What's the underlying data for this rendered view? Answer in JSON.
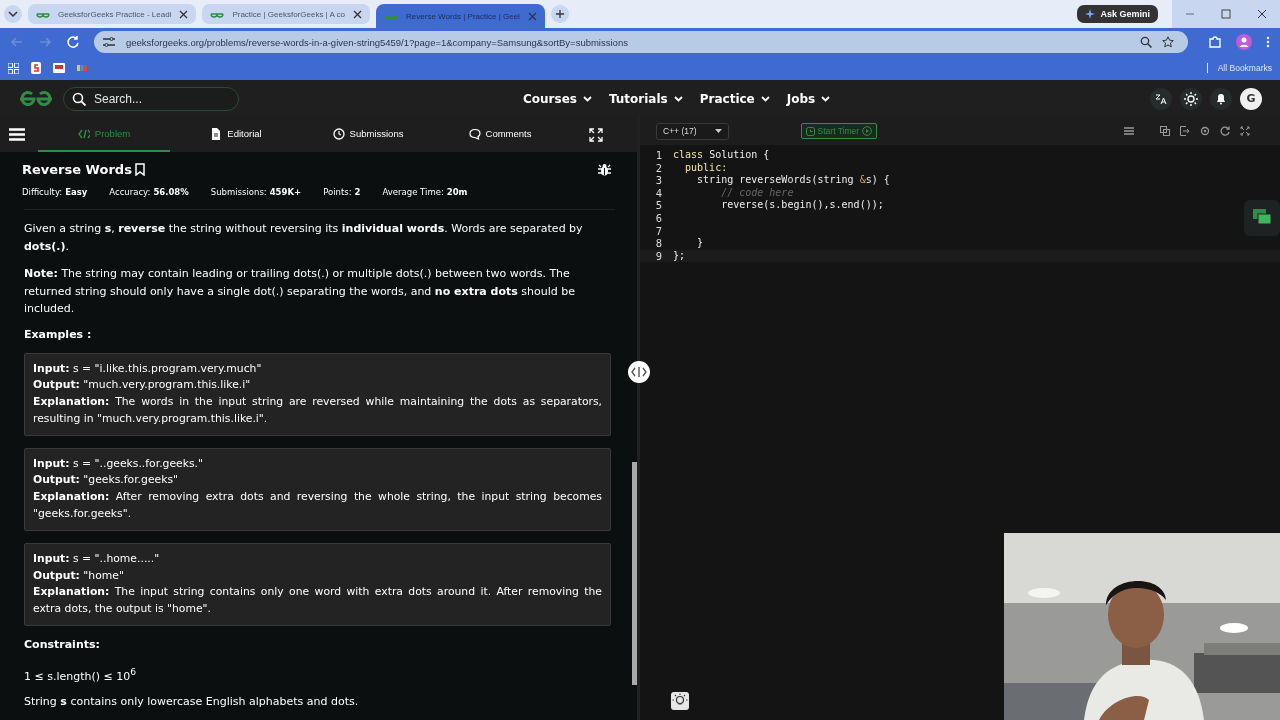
{
  "browser": {
    "tabs": [
      {
        "title": "GeeksforGeeks Practice - Leadi",
        "selected": false
      },
      {
        "title": "Practice | GeeksforGeeks | A co",
        "selected": false
      },
      {
        "title": "Reverse Words | Practice | Geel",
        "selected": true
      }
    ],
    "ask_button": "Ask Gemini",
    "url": "geeksforgeeks.org/problems/reverse-words-in-a-given-string5459/1?page=1&company=Samsung&sortBy=submissions",
    "bookmarks_label": "All Bookmarks"
  },
  "site_header": {
    "search_placeholder": "Search...",
    "nav": [
      "Courses",
      "Tutorials",
      "Practice",
      "Jobs"
    ],
    "avatar": "G"
  },
  "problem_tabs": [
    {
      "label": "Problem",
      "selected": true
    },
    {
      "label": "Editorial",
      "selected": false
    },
    {
      "label": "Submissions",
      "selected": false
    },
    {
      "label": "Comments",
      "selected": false
    }
  ],
  "problem": {
    "title": "Reverse Words",
    "meta": [
      {
        "label": "Difficulty:",
        "value": "Easy"
      },
      {
        "label": "Accuracy:",
        "value": "56.08%"
      },
      {
        "label": "Submissions:",
        "value": "459K+"
      },
      {
        "label": "Points:",
        "value": "2"
      },
      {
        "label": "Average Time:",
        "value": "20m"
      }
    ],
    "paragraphs": [
      "Given a string **s**, **reverse** the string without reversing its **individual words**. Words are separated by **dots(.)**.",
      "**Note:** The string may contain leading or trailing dots(.) or multiple dots(.) between two words. The returned string should only have a single dot(.) separating the words, and **no extra dots** should be included."
    ],
    "examples_heading": "Examples :",
    "examples": [
      [
        "**Input:** s = \"i.like.this.program.very.much\"",
        "**Output:** \"much.very.program.this.like.i\"",
        "**Explanation:** The words in the input string are reversed while maintaining the dots as separators, resulting in \"much.very.program.this.like.i\"."
      ],
      [
        "**Input:** s = \"..geeks..for.geeks.\"",
        "**Output:** \"geeks.for.geeks\"",
        "**Explanation:** After removing extra dots and reversing the whole string, the input string becomes \"geeks.for.geeks\"."
      ],
      [
        "**Input:** s = \"..home.....\"",
        "**Output:** \"home\"",
        "**Explanation:** The input string contains only one word with extra dots around it. After removing the extra dots, the output is \"home\"."
      ]
    ],
    "constraints_heading": "Constraints:",
    "constraints": [
      "1 ≤ s.length() ≤ 10$^{6}$",
      "String **s** contains only lowercase English alphabets and dots."
    ]
  },
  "editor": {
    "language": "C++ (17)",
    "timer_button": "Start Timer",
    "lines": [
      {
        "number": "1",
        "tokens": [
          {
            "text": "class",
            "kind": "keyword"
          },
          {
            "text": " Solution {",
            "kind": "plain"
          }
        ]
      },
      {
        "number": "2",
        "tokens": [
          {
            "text": "  public:",
            "kind": "keyword"
          }
        ]
      },
      {
        "number": "3",
        "tokens": [
          {
            "text": "    string reverseWords(string ",
            "kind": "plain"
          },
          {
            "text": "&",
            "kind": "operator"
          },
          {
            "text": "s) {",
            "kind": "plain"
          }
        ]
      },
      {
        "number": "4",
        "tokens": [
          {
            "text": "        // code here",
            "kind": "comment"
          }
        ]
      },
      {
        "number": "5",
        "tokens": [
          {
            "text": "        reverse(s.begin(),s.end());",
            "kind": "plain"
          }
        ]
      },
      {
        "number": "6"
      },
      {
        "number": "7"
      },
      {
        "number": "8",
        "tokens": [
          {
            "text": "    }",
            "kind": "plain"
          }
        ]
      },
      {
        "number": "9",
        "tokens": [
          {
            "text": "};",
            "kind": "plain"
          }
        ]
      }
    ]
  }
}
